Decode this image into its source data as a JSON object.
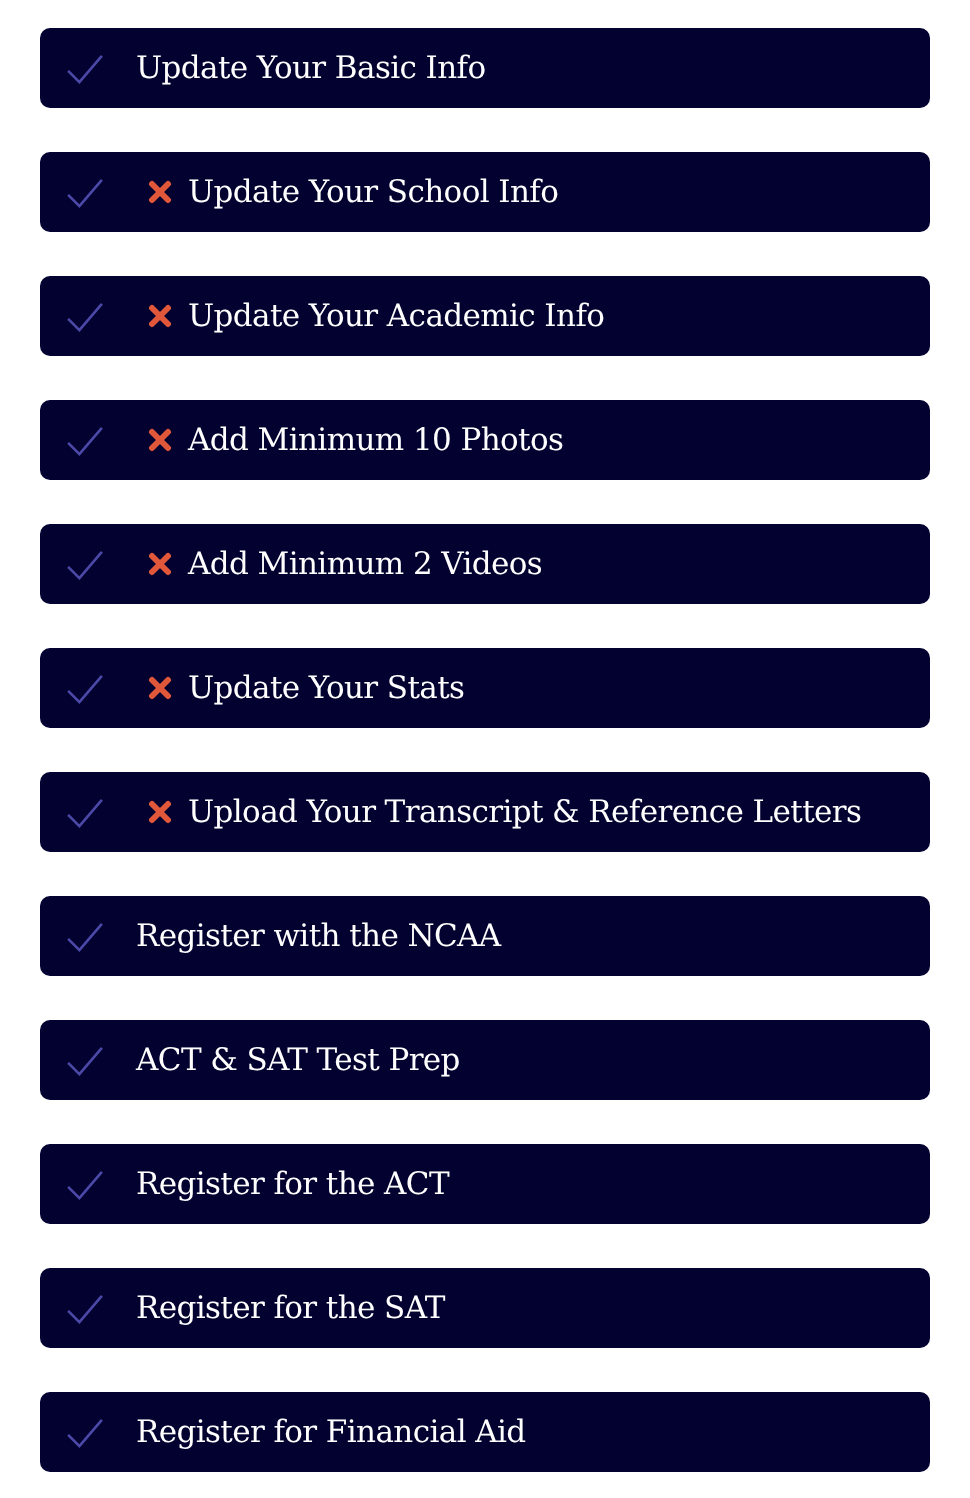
{
  "checklist": [
    {
      "label": "Update Your Basic Info",
      "incomplete": false
    },
    {
      "label": "Update Your School Info",
      "incomplete": true
    },
    {
      "label": "Update Your Academic Info",
      "incomplete": true
    },
    {
      "label": "Add Minimum 10 Photos",
      "incomplete": true
    },
    {
      "label": "Add Minimum 2 Videos",
      "incomplete": true
    },
    {
      "label": "Update Your Stats",
      "incomplete": true
    },
    {
      "label": "Upload Your Transcript & Reference Letters",
      "incomplete": true
    },
    {
      "label": "Register with the NCAA",
      "incomplete": false
    },
    {
      "label": "ACT & SAT Test Prep",
      "incomplete": false
    },
    {
      "label": "Register for the ACT",
      "incomplete": false
    },
    {
      "label": "Register for the SAT",
      "incomplete": false
    },
    {
      "label": "Register for Financial Aid",
      "incomplete": false
    }
  ]
}
